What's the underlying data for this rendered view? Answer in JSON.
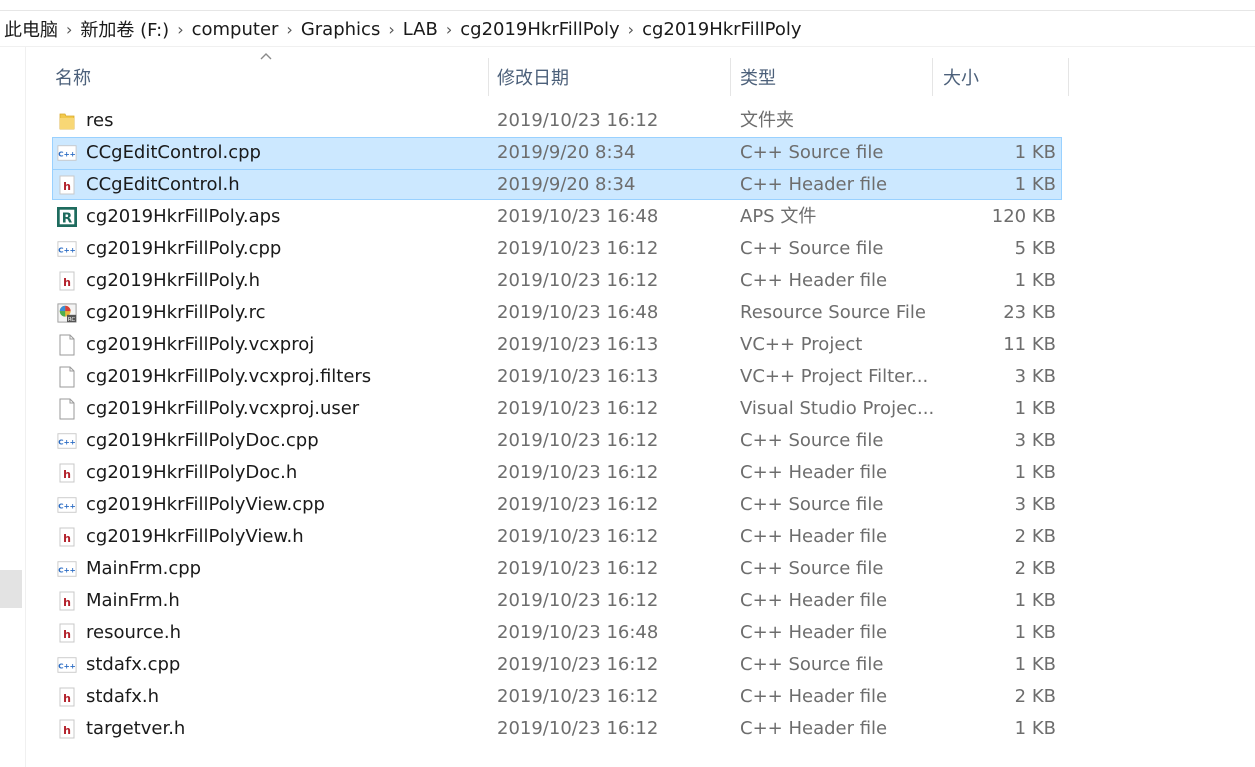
{
  "breadcrumb": [
    "此电脑",
    "新加卷 (F:)",
    "computer",
    "Graphics",
    "LAB",
    "cg2019HkrFillPoly",
    "cg2019HkrFillPoly"
  ],
  "columns": {
    "name": "名称",
    "date": "修改日期",
    "type": "类型",
    "size": "大小"
  },
  "files": [
    {
      "name": "res",
      "date": "2019/10/23 16:12",
      "type": "文件夹",
      "size": "",
      "icon": "folder-icon",
      "selected": false
    },
    {
      "name": "CCgEditControl.cpp",
      "date": "2019/9/20 8:34",
      "type": "C++ Source file",
      "size": "1 KB",
      "icon": "cpp-file-icon",
      "selected": true
    },
    {
      "name": "CCgEditControl.h",
      "date": "2019/9/20 8:34",
      "type": "C++ Header file",
      "size": "1 KB",
      "icon": "header-file-icon",
      "selected": true
    },
    {
      "name": "cg2019HkrFillPoly.aps",
      "date": "2019/10/23 16:48",
      "type": "APS 文件",
      "size": "120 KB",
      "icon": "aps-file-icon",
      "selected": false
    },
    {
      "name": "cg2019HkrFillPoly.cpp",
      "date": "2019/10/23 16:12",
      "type": "C++ Source file",
      "size": "5 KB",
      "icon": "cpp-file-icon",
      "selected": false
    },
    {
      "name": "cg2019HkrFillPoly.h",
      "date": "2019/10/23 16:12",
      "type": "C++ Header file",
      "size": "1 KB",
      "icon": "header-file-icon",
      "selected": false
    },
    {
      "name": "cg2019HkrFillPoly.rc",
      "date": "2019/10/23 16:48",
      "type": "Resource Source File",
      "size": "23 KB",
      "icon": "rc-file-icon",
      "selected": false
    },
    {
      "name": "cg2019HkrFillPoly.vcxproj",
      "date": "2019/10/23 16:13",
      "type": "VC++ Project",
      "size": "11 KB",
      "icon": "blank-file-icon",
      "selected": false
    },
    {
      "name": "cg2019HkrFillPoly.vcxproj.filters",
      "date": "2019/10/23 16:13",
      "type": "VC++ Project Filter...",
      "size": "3 KB",
      "icon": "blank-file-icon",
      "selected": false
    },
    {
      "name": "cg2019HkrFillPoly.vcxproj.user",
      "date": "2019/10/23 16:12",
      "type": "Visual Studio Projec...",
      "size": "1 KB",
      "icon": "blank-file-icon",
      "selected": false
    },
    {
      "name": "cg2019HkrFillPolyDoc.cpp",
      "date": "2019/10/23 16:12",
      "type": "C++ Source file",
      "size": "3 KB",
      "icon": "cpp-file-icon",
      "selected": false
    },
    {
      "name": "cg2019HkrFillPolyDoc.h",
      "date": "2019/10/23 16:12",
      "type": "C++ Header file",
      "size": "1 KB",
      "icon": "header-file-icon",
      "selected": false
    },
    {
      "name": "cg2019HkrFillPolyView.cpp",
      "date": "2019/10/23 16:12",
      "type": "C++ Source file",
      "size": "3 KB",
      "icon": "cpp-file-icon",
      "selected": false
    },
    {
      "name": "cg2019HkrFillPolyView.h",
      "date": "2019/10/23 16:12",
      "type": "C++ Header file",
      "size": "2 KB",
      "icon": "header-file-icon",
      "selected": false
    },
    {
      "name": "MainFrm.cpp",
      "date": "2019/10/23 16:12",
      "type": "C++ Source file",
      "size": "2 KB",
      "icon": "cpp-file-icon",
      "selected": false
    },
    {
      "name": "MainFrm.h",
      "date": "2019/10/23 16:12",
      "type": "C++ Header file",
      "size": "1 KB",
      "icon": "header-file-icon",
      "selected": false
    },
    {
      "name": "resource.h",
      "date": "2019/10/23 16:48",
      "type": "C++ Header file",
      "size": "1 KB",
      "icon": "header-file-icon",
      "selected": false
    },
    {
      "name": "stdafx.cpp",
      "date": "2019/10/23 16:12",
      "type": "C++ Source file",
      "size": "1 KB",
      "icon": "cpp-file-icon",
      "selected": false
    },
    {
      "name": "stdafx.h",
      "date": "2019/10/23 16:12",
      "type": "C++ Header file",
      "size": "2 KB",
      "icon": "header-file-icon",
      "selected": false
    },
    {
      "name": "targetver.h",
      "date": "2019/10/23 16:12",
      "type": "C++ Header file",
      "size": "1 KB",
      "icon": "header-file-icon",
      "selected": false
    }
  ],
  "colors": {
    "selection": "#cce8ff",
    "selection_border": "#99d1ff",
    "header_text": "#4c607a",
    "meta_text": "#6d6d6d"
  }
}
